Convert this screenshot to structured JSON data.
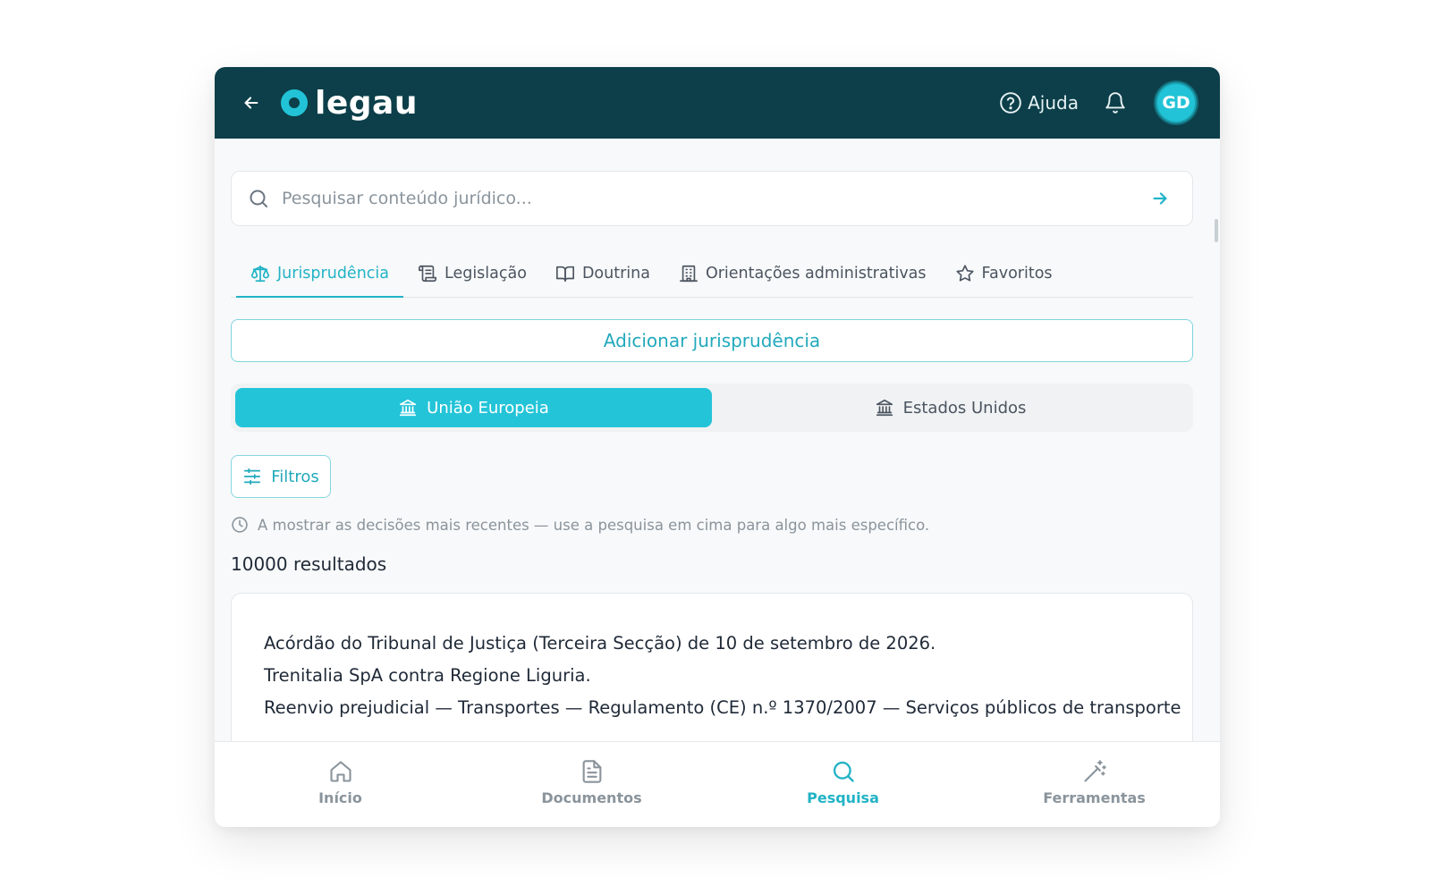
{
  "header": {
    "logo_text": "legau",
    "help_label": "Ajuda",
    "avatar_initials": "GD"
  },
  "search": {
    "placeholder": "Pesquisar conteúdo jurídico..."
  },
  "tabs": [
    {
      "label": "Jurisprudência",
      "icon": "scales-icon",
      "active": true
    },
    {
      "label": "Legislação",
      "icon": "scroll-icon",
      "active": false
    },
    {
      "label": "Doutrina",
      "icon": "book-open-icon",
      "active": false
    },
    {
      "label": "Orientações administrativas",
      "icon": "building-icon",
      "active": false
    },
    {
      "label": "Favoritos",
      "icon": "star-icon",
      "active": false
    }
  ],
  "add_button_label": "Adicionar jurisprudência",
  "regions": [
    {
      "label": "União Europeia",
      "icon": "landmark-icon",
      "active": true
    },
    {
      "label": "Estados Unidos",
      "icon": "landmark-icon",
      "active": false
    }
  ],
  "filters_label": "Filtros",
  "info_text": "A mostrar as decisões mais recentes — use a pesquisa em cima para algo mais específico.",
  "results_count": "10000 resultados",
  "result": {
    "lines": [
      "Acórdão do Tribunal de Justiça (Terceira Secção) de 10 de setembro de 2026.",
      "Trenitalia SpA contra Regione Liguria.",
      "Reenvio prejudicial — Transportes — Regulamento (CE) n.º 1370/2007 — Serviços públicos de transporte"
    ]
  },
  "bottom_nav": [
    {
      "label": "Início",
      "icon": "home-icon",
      "active": false
    },
    {
      "label": "Documentos",
      "icon": "document-icon",
      "active": false
    },
    {
      "label": "Pesquisa",
      "icon": "search-icon",
      "active": true
    },
    {
      "label": "Ferramentas",
      "icon": "magic-wand-icon",
      "active": false
    }
  ],
  "colors": {
    "header_bg": "#0c3f49",
    "accent": "#22c3d6",
    "accent_text": "#22b3c6",
    "muted": "#8a949c"
  }
}
